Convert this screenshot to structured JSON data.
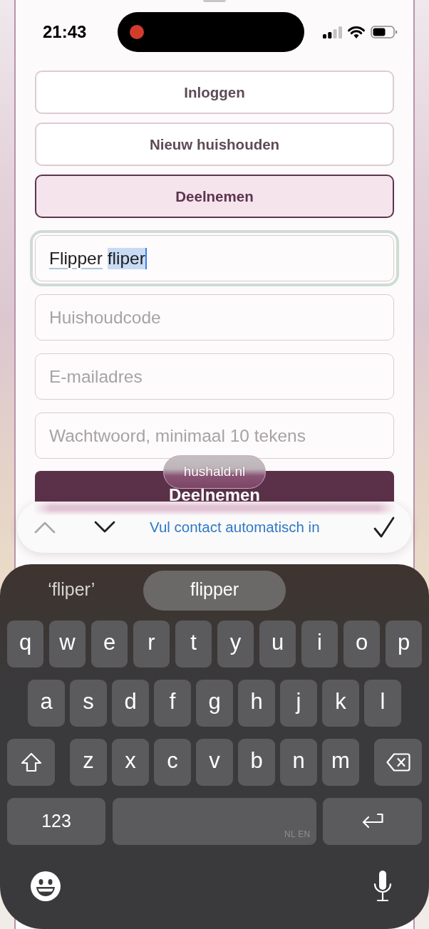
{
  "status_bar": {
    "time": "21:43",
    "recording": true
  },
  "mode_buttons": [
    {
      "label": "Inloggen",
      "selected": false
    },
    {
      "label": "Nieuw huishouden",
      "selected": false
    },
    {
      "label": "Deelnemen",
      "selected": true
    }
  ],
  "fields": [
    {
      "focused": true,
      "value_words": [
        {
          "text": "Flipper",
          "underlined": true,
          "selected": false
        },
        {
          "text": "fliper",
          "underlined": false,
          "selected": true
        }
      ]
    },
    {
      "focused": false,
      "placeholder": "Huishoudcode"
    },
    {
      "focused": false,
      "placeholder": "E-mailadres"
    },
    {
      "focused": false,
      "placeholder": "Wachtwoord, minimaal 10 tekens"
    }
  ],
  "submit_button": {
    "label": "Deelnemen"
  },
  "url_pill": {
    "url": "hushald.nl"
  },
  "accessory_bar": {
    "nav_buttons": [
      {
        "kind": "previous",
        "disabled": true
      },
      {
        "kind": "next",
        "disabled": false
      }
    ],
    "autofill_label": "Vul contact automatisch in"
  },
  "keyboard": {
    "suggestions": [
      {
        "text": "‘fliper’",
        "selected": false
      },
      {
        "text": "flipper",
        "selected": true
      }
    ],
    "rows": [
      [
        "q",
        "w",
        "e",
        "r",
        "t",
        "y",
        "u",
        "i",
        "o",
        "p"
      ],
      [
        "a",
        "s",
        "d",
        "f",
        "g",
        "h",
        "j",
        "k",
        "l"
      ],
      [
        "z",
        "x",
        "c",
        "v",
        "b",
        "n",
        "m"
      ]
    ],
    "shift_on": false,
    "number_key": "123",
    "space_languages": "NL EN"
  }
}
